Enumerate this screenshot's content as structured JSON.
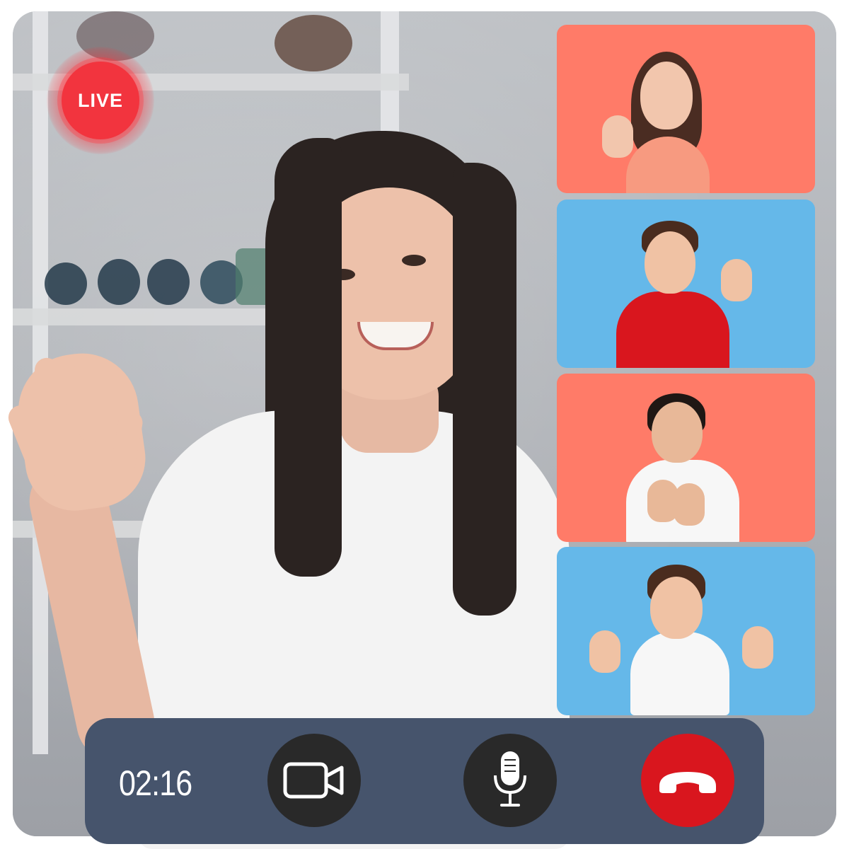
{
  "call": {
    "live_label": "LIVE",
    "timer": "02:16"
  },
  "participants": [
    {
      "background": "#ff7b68"
    },
    {
      "background": "#65b8e9"
    },
    {
      "background": "#ff7b68"
    },
    {
      "background": "#65b8e9"
    }
  ],
  "controls": {
    "video_icon": "video-camera-icon",
    "mic_icon": "microphone-icon",
    "end_icon": "phone-hangup-icon"
  },
  "colors": {
    "live_red": "#f2343e",
    "control_bar": "#46546c",
    "button_dark": "#292929",
    "end_call_red": "#d9161e"
  }
}
